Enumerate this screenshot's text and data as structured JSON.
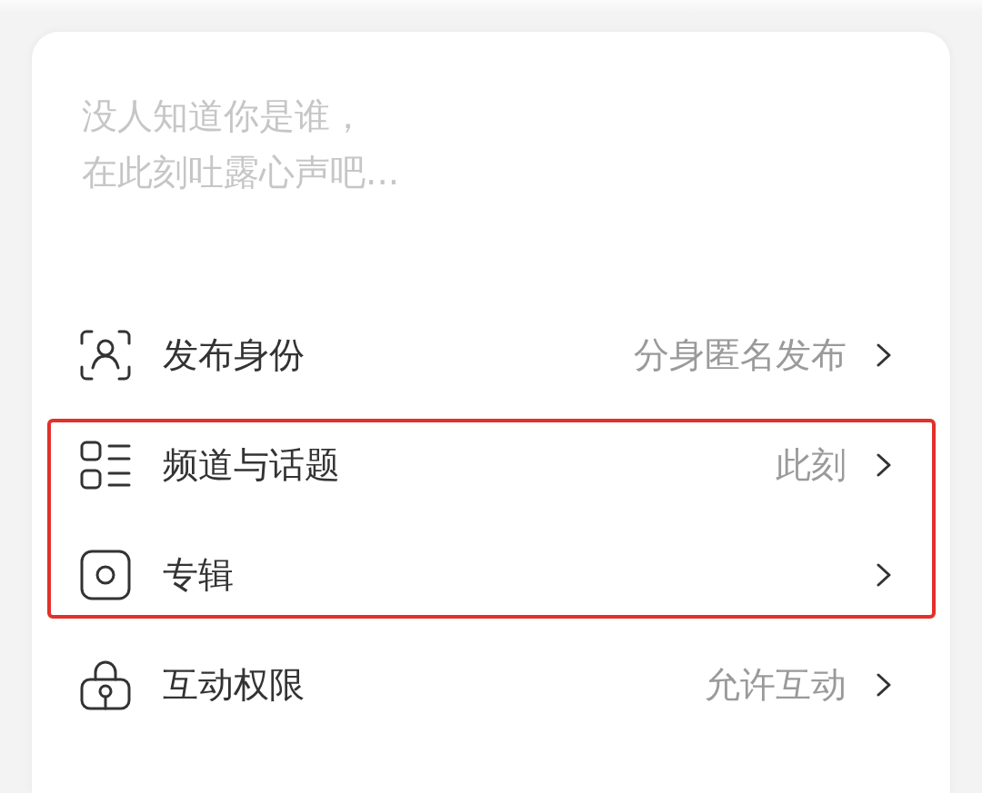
{
  "composer": {
    "placeholder": [
      "没人知道你是谁，",
      "在此刻吐露心声吧..."
    ]
  },
  "settings": [
    {
      "kind": "identity",
      "label": "发布身份",
      "value": "分身匿名发布",
      "highlighted": false
    },
    {
      "kind": "channel",
      "label": "频道与话题",
      "value": "此刻",
      "highlighted": true
    },
    {
      "kind": "album",
      "label": "专辑",
      "highlighted": true
    },
    {
      "kind": "permission",
      "label": "互动权限",
      "value": "允许互动",
      "highlighted": false
    }
  ]
}
